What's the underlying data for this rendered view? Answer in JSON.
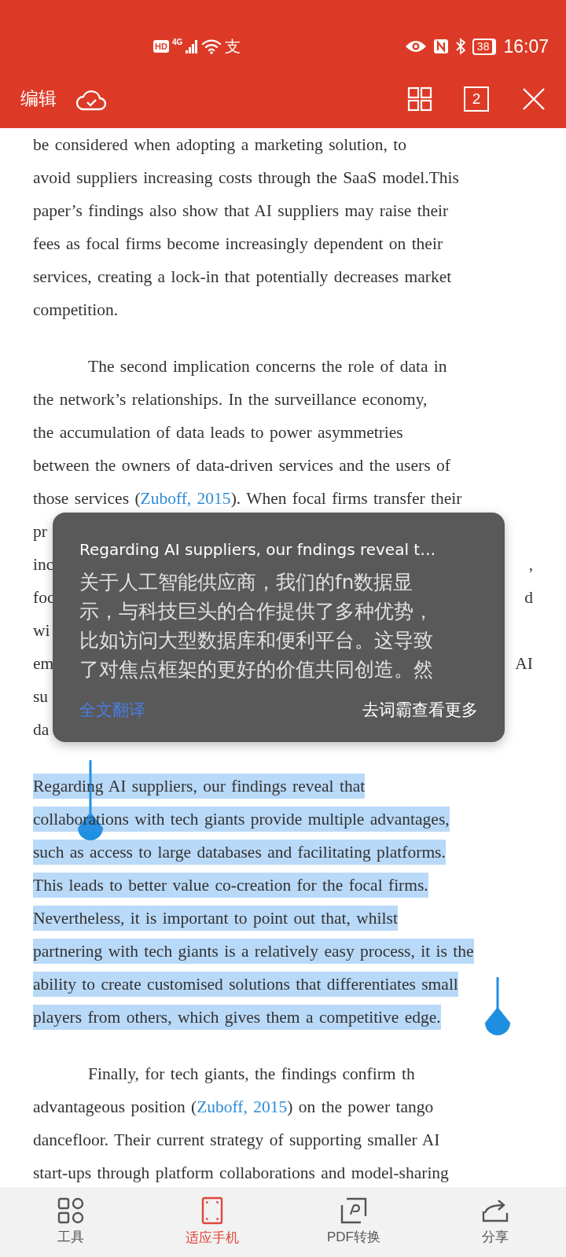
{
  "status_bar": {
    "hd": "HD",
    "network": "4G",
    "app_glyph": "支",
    "battery": "38",
    "time": "16:07"
  },
  "toolbar": {
    "edit": "编辑",
    "page_count": "2"
  },
  "document": {
    "paragraphs": [
      {
        "indent": false,
        "highlighted": false,
        "lines": [
          {
            "text": "be considered when adopting a marketing solution, to"
          },
          {
            "text": "avoid suppliers increasing costs through the SaaS model.This"
          },
          {
            "text": "paper’s findings also show that AI suppliers may raise their"
          },
          {
            "text": "fees as focal firms become increasingly dependent on their"
          },
          {
            "text": "services, creating a lock-in that potentially decreases market"
          },
          {
            "text": "competition."
          }
        ]
      },
      {
        "indent": true,
        "highlighted": false,
        "lines": [
          {
            "text": "The second implication concerns the role of data in"
          },
          {
            "text": "the network’s relationships. In the surveillance economy,"
          },
          {
            "text": "the accumulation of data leads to power asymmetries"
          },
          {
            "text": "between the owners of data-driven services and the users of"
          },
          {
            "parts": [
              {
                "text": "those services ("
              },
              {
                "text": "Zuboff, 2015",
                "kind": "link"
              },
              {
                "text": "). When focal firms transfer their"
              }
            ]
          },
          {
            "left": "pr"
          },
          {
            "left": "inc",
            "right": ","
          },
          {
            "left": "foc",
            "right": "d"
          },
          {
            "left": "wi"
          },
          {
            "left": "em",
            "right": "AI"
          },
          {
            "left": "su"
          },
          {
            "left": "da"
          }
        ]
      },
      {
        "indent": false,
        "highlighted": true,
        "lines": [
          {
            "text": "Regarding AI suppliers, our findings reveal that"
          },
          {
            "text": "collaborations with tech giants provide multiple advantages,"
          },
          {
            "text": "such as access to large databases and facilitating platforms."
          },
          {
            "text": "This leads to better value co-creation for the focal firms."
          },
          {
            "text": "Nevertheless, it is important to point out that, whilst"
          },
          {
            "text": "partnering with tech giants is a relatively easy process, it is the"
          },
          {
            "text": "ability to create customised solutions that differentiates small"
          },
          {
            "text": "players from others, which gives them a competitive edge."
          }
        ]
      },
      {
        "indent": true,
        "highlighted": false,
        "lines": [
          {
            "text": "Finally, for tech giants, the findings confirm th"
          },
          {
            "parts": [
              {
                "text": "advantageous position ("
              },
              {
                "text": "Zuboff, 2015",
                "kind": "link"
              },
              {
                "text": ") on the power tango"
              }
            ]
          },
          {
            "text": "dancefloor. Their current strategy of supporting smaller AI"
          },
          {
            "text": "start-ups through platform collaborations and model-sharing"
          }
        ]
      }
    ]
  },
  "translation_popup": {
    "source": "Regarding AI suppliers, our fndings reveal t…",
    "translation_lines": [
      "关于人工智能供应商，我们的fn数据显",
      "示，与科技巨头的合作提供了多种优势，",
      "比如访问大型数据库和便利平台。这导致",
      "了对焦点框架的更好的价值共同创造。然"
    ],
    "full_translate": "全文翻译",
    "more": "去词霸查看更多"
  },
  "bottom_nav": [
    {
      "kind": "tools",
      "label": "工具",
      "selected": false
    },
    {
      "kind": "fit",
      "label": "适应手机",
      "selected": true
    },
    {
      "kind": "pdf",
      "label": "PDF转换",
      "selected": false
    },
    {
      "kind": "share",
      "label": "分享",
      "selected": false
    }
  ]
}
